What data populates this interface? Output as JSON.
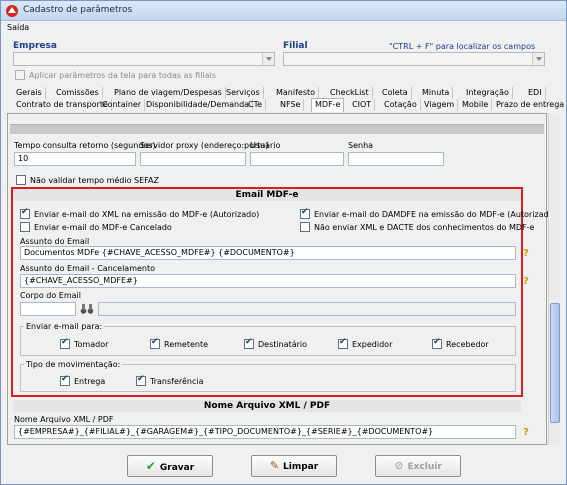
{
  "window": {
    "title": "Cadastro de parâmetros"
  },
  "menu": {
    "saida": "Saída"
  },
  "header": {
    "empresa_label": "Empresa",
    "filial_label": "Filial",
    "hint": "\"CTRL + F\" para localizar os campos",
    "apply_all_label": "Aplicar parâmetros da tela para todas as filiais"
  },
  "tabs_row1": [
    "Gerais",
    "Comissões",
    "Plano de viagem/Despesas",
    "Serviços",
    "Manifesto",
    "CheckList",
    "Coleta",
    "Minuta",
    "Integração",
    "EDI"
  ],
  "tabs_row2": [
    "Contrato de transporte",
    "Container",
    "Disponibilidade/Demanda",
    "CTe",
    "NFSe",
    "MDF-e",
    "CIOT",
    "Cotação",
    "Viagem",
    "Mobile",
    "Prazo de entrega"
  ],
  "fields": {
    "tempo_label": "Tempo consulta retorno (segundos)",
    "tempo_value": "10",
    "proxy_label": "Servidor proxy (endereço:porta)",
    "usuario_label": "Usuário",
    "senha_label": "Senha",
    "nao_validar_label": "Não validar tempo médio SEFAZ"
  },
  "email": {
    "section_title": "Email MDF-e",
    "opt_xml": "Enviar e-mail do XML na emissão do MDF-e (Autorizado)",
    "opt_damdfe": "Enviar e-mail do DAMDFE na emissão do MDF-e (Autorizado)",
    "opt_cancelado": "Enviar e-mail do MDF-e Cancelado",
    "opt_nao_enviar": "Não enviar XML e DACTE dos conhecimentos do MDF-e",
    "assunto_label": "Assunto do Email",
    "assunto_value": "Documentos MDFe {#CHAVE_ACESSO_MDFE#} {#DOCUMENTO#}",
    "assunto_cancel_label": "Assunto do Email - Cancelamento",
    "assunto_cancel_value": "{#CHAVE_ACESSO_MDFE#}",
    "corpo_label": "Corpo do Email",
    "enviar_para_label": "Enviar e-mail para:",
    "recipients": [
      "Tomador",
      "Remetente",
      "Destinatário",
      "Expedidor",
      "Recebedor"
    ],
    "tipo_mov_label": "Tipo de movimentação:",
    "movimentos": [
      "Entrega",
      "Transferência"
    ]
  },
  "xml_section": {
    "title": "Nome Arquivo XML / PDF",
    "label": "Nome Arquivo XML / PDF",
    "value": "{#EMPRESA#}_{#FILIAL#}_{#GARAGEM#}_{#TIPO_DOCUMENTO#}_{#SERIE#}_{#DOCUMENTO#}"
  },
  "buttons": {
    "gravar": "Gravar",
    "limpar": "Limpar",
    "excluir": "Excluir"
  },
  "colors": {
    "highlight_border": "#d42020",
    "accent_blue": "#1c3d8c"
  }
}
